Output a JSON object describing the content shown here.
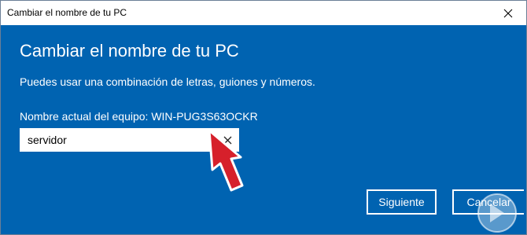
{
  "window": {
    "title": "Cambiar el nombre de tu PC"
  },
  "dialog": {
    "heading": "Cambiar el nombre de tu PC",
    "description": "Puedes usar una combinación de letras, guiones y números.",
    "current_name_label": "Nombre actual del equipo: WIN-PUG3S63OCKR"
  },
  "name_input": {
    "value": "servidor"
  },
  "buttons": {
    "next": "Siguiente",
    "cancel": "Cancelar"
  },
  "colors": {
    "dialog_background": "#0063b1",
    "annotation_arrow": "#d6202b"
  },
  "icons": [
    "close-icon",
    "clear-text-icon",
    "annotation-arrow-icon",
    "watermark-logo"
  ]
}
